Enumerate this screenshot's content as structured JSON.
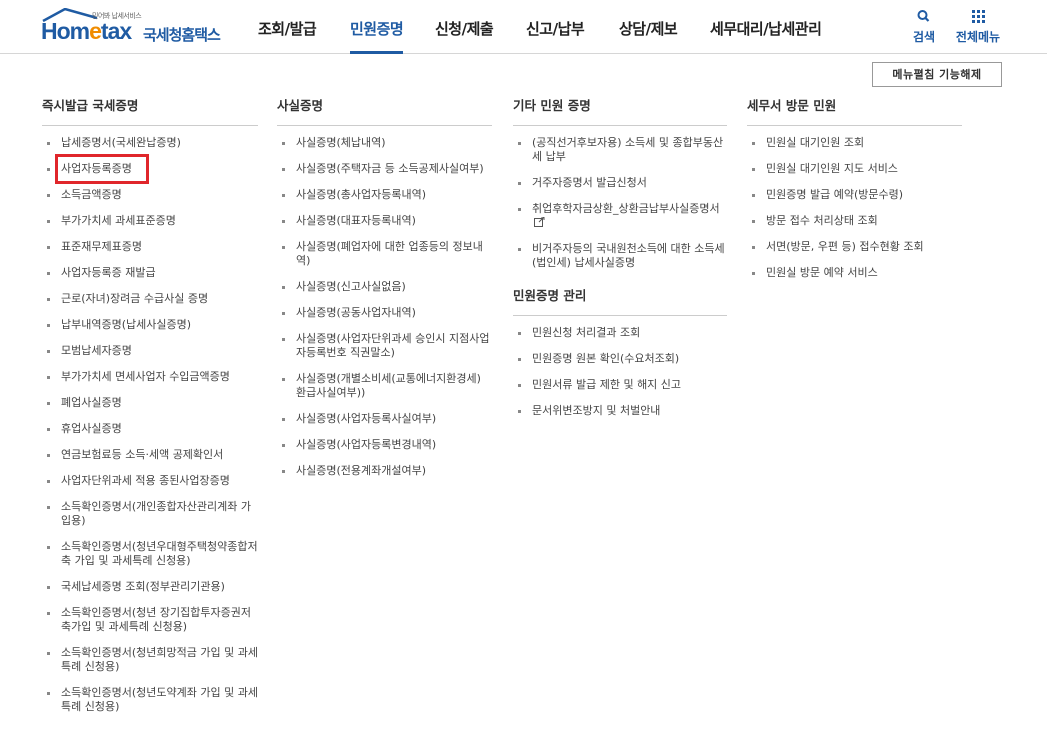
{
  "header": {
    "logo_slogan": "믿어봐 납세서비스",
    "logo_home": "Hom",
    "logo_e": "e",
    "logo_tax": "tax",
    "logo_sub": "국세청홈택스",
    "nav": [
      "조회/발급",
      "민원증명",
      "신청/제출",
      "신고/납부",
      "상담/제보",
      "세무대리/납세관리"
    ],
    "active_nav": "민원증명",
    "search_label": "검색",
    "allmenu_label": "전체메뉴"
  },
  "release_button": "메뉴펼침 기능해제",
  "columns": {
    "c1": {
      "title": "즉시발급 국세증명",
      "items": [
        "납세증명서(국세완납증명)",
        "사업자등록증명",
        "소득금액증명",
        "부가가치세 과세표준증명",
        "표준재무제표증명",
        "사업자등록증 재발급",
        "근로(자녀)장려금 수급사실 증명",
        "납부내역증명(납세사실증명)",
        "모범납세자증명",
        "부가가치세 면세사업자 수입금액증명",
        "폐업사실증명",
        "휴업사실증명",
        "연금보험료등 소득·세액 공제확인서",
        "사업자단위과세 적용 종된사업장증명",
        "소득확인증명서(개인종합자산관리계좌 가입용)",
        "소득확인증명서(청년우대형주택청약종합저축 가입 및 과세특례 신청용)",
        "국세납세증명 조회(정부관리기관용)",
        "소득확인증명서(청년 장기집합투자증권저축가입 및 과세특례 신청용)",
        "소득확인증명서(청년희망적금 가입 및 과세특례 신청용)",
        "소득확인증명서(청년도약계좌 가입 및 과세특례 신청용)"
      ]
    },
    "c2": {
      "title": "사실증명",
      "items": [
        "사실증명(체납내역)",
        "사실증명(주택자금 등 소득공제사실여부)",
        "사실증명(총사업자등록내역)",
        "사실증명(대표자등록내역)",
        "사실증명(폐업자에 대한 업종등의 정보내역)",
        "사실증명(신고사실없음)",
        "사실증명(공동사업자내역)",
        "사실증명(사업자단위과세 승인시 지점사업자등록번호 직권말소)",
        "사실증명(개별소비세(교통에너지환경세) 환급사실여부))",
        "사실증명(사업자등록사실여부)",
        "사실증명(사업자등록변경내역)",
        "사실증명(전용계좌개설여부)"
      ]
    },
    "c3": {
      "title": "기타 민원 증명",
      "items": [
        "(공직선거후보자용) 소득세 및 종합부동산세 납부",
        "거주자증명서 발급신청서",
        "취업후학자금상환_상환금납부사실증명서",
        "비거주자등의 국내원천소득에 대한 소득세(법인세) 납세사실증명"
      ]
    },
    "c3b": {
      "title": "민원증명 관리",
      "items": [
        "민원신청 처리결과 조회",
        "민원증명 원본 확인(수요처조회)",
        "민원서류 발급 제한 및 해지 신고",
        "문서위변조방지 및 처벌안내"
      ]
    },
    "c4": {
      "title": "세무서 방문 민원",
      "items": [
        "민원실 대기인원 조회",
        "민원실 대기인원 지도 서비스",
        "민원증명 발급 예약(방문수령)",
        "방문 접수 처리상태 조회",
        "서면(방문, 우편 등) 접수현황 조회",
        "민원실 방문 예약 서비스"
      ]
    }
  },
  "colors": {
    "brand": "#1f5ba3",
    "accent": "#f08c00",
    "highlight": "#e0262b"
  },
  "icons": [
    "search-icon",
    "grid-menu-icon",
    "external-link-icon"
  ]
}
